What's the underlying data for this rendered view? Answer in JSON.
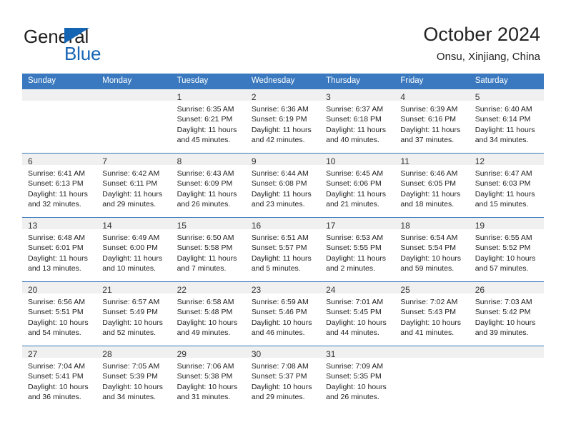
{
  "brand": {
    "name_top": "General",
    "name_bottom": "Blue",
    "accent_color": "#1464b4",
    "triangle_icon": "brand-triangle-icon"
  },
  "header": {
    "title": "October 2024",
    "subtitle": "Onsu, Xinjiang, China"
  },
  "theme": {
    "header_blue": "#3a79bf",
    "daynum_gray": "#f0f0f0",
    "text": "#222222"
  },
  "weekday_headers": [
    "Sunday",
    "Monday",
    "Tuesday",
    "Wednesday",
    "Thursday",
    "Friday",
    "Saturday"
  ],
  "labels": {
    "sunrise": "Sunrise:",
    "sunset": "Sunset:",
    "daylight": "Daylight:"
  },
  "weeks": [
    [
      {
        "day": "",
        "lines": []
      },
      {
        "day": "",
        "lines": []
      },
      {
        "day": "1",
        "lines": [
          "Sunrise: 6:35 AM",
          "Sunset: 6:21 PM",
          "Daylight: 11 hours and 45 minutes."
        ]
      },
      {
        "day": "2",
        "lines": [
          "Sunrise: 6:36 AM",
          "Sunset: 6:19 PM",
          "Daylight: 11 hours and 42 minutes."
        ]
      },
      {
        "day": "3",
        "lines": [
          "Sunrise: 6:37 AM",
          "Sunset: 6:18 PM",
          "Daylight: 11 hours and 40 minutes."
        ]
      },
      {
        "day": "4",
        "lines": [
          "Sunrise: 6:39 AM",
          "Sunset: 6:16 PM",
          "Daylight: 11 hours and 37 minutes."
        ]
      },
      {
        "day": "5",
        "lines": [
          "Sunrise: 6:40 AM",
          "Sunset: 6:14 PM",
          "Daylight: 11 hours and 34 minutes."
        ]
      }
    ],
    [
      {
        "day": "6",
        "lines": [
          "Sunrise: 6:41 AM",
          "Sunset: 6:13 PM",
          "Daylight: 11 hours and 32 minutes."
        ]
      },
      {
        "day": "7",
        "lines": [
          "Sunrise: 6:42 AM",
          "Sunset: 6:11 PM",
          "Daylight: 11 hours and 29 minutes."
        ]
      },
      {
        "day": "8",
        "lines": [
          "Sunrise: 6:43 AM",
          "Sunset: 6:09 PM",
          "Daylight: 11 hours and 26 minutes."
        ]
      },
      {
        "day": "9",
        "lines": [
          "Sunrise: 6:44 AM",
          "Sunset: 6:08 PM",
          "Daylight: 11 hours and 23 minutes."
        ]
      },
      {
        "day": "10",
        "lines": [
          "Sunrise: 6:45 AM",
          "Sunset: 6:06 PM",
          "Daylight: 11 hours and 21 minutes."
        ]
      },
      {
        "day": "11",
        "lines": [
          "Sunrise: 6:46 AM",
          "Sunset: 6:05 PM",
          "Daylight: 11 hours and 18 minutes."
        ]
      },
      {
        "day": "12",
        "lines": [
          "Sunrise: 6:47 AM",
          "Sunset: 6:03 PM",
          "Daylight: 11 hours and 15 minutes."
        ]
      }
    ],
    [
      {
        "day": "13",
        "lines": [
          "Sunrise: 6:48 AM",
          "Sunset: 6:01 PM",
          "Daylight: 11 hours and 13 minutes."
        ]
      },
      {
        "day": "14",
        "lines": [
          "Sunrise: 6:49 AM",
          "Sunset: 6:00 PM",
          "Daylight: 11 hours and 10 minutes."
        ]
      },
      {
        "day": "15",
        "lines": [
          "Sunrise: 6:50 AM",
          "Sunset: 5:58 PM",
          "Daylight: 11 hours and 7 minutes."
        ]
      },
      {
        "day": "16",
        "lines": [
          "Sunrise: 6:51 AM",
          "Sunset: 5:57 PM",
          "Daylight: 11 hours and 5 minutes."
        ]
      },
      {
        "day": "17",
        "lines": [
          "Sunrise: 6:53 AM",
          "Sunset: 5:55 PM",
          "Daylight: 11 hours and 2 minutes."
        ]
      },
      {
        "day": "18",
        "lines": [
          "Sunrise: 6:54 AM",
          "Sunset: 5:54 PM",
          "Daylight: 10 hours and 59 minutes."
        ]
      },
      {
        "day": "19",
        "lines": [
          "Sunrise: 6:55 AM",
          "Sunset: 5:52 PM",
          "Daylight: 10 hours and 57 minutes."
        ]
      }
    ],
    [
      {
        "day": "20",
        "lines": [
          "Sunrise: 6:56 AM",
          "Sunset: 5:51 PM",
          "Daylight: 10 hours and 54 minutes."
        ]
      },
      {
        "day": "21",
        "lines": [
          "Sunrise: 6:57 AM",
          "Sunset: 5:49 PM",
          "Daylight: 10 hours and 52 minutes."
        ]
      },
      {
        "day": "22",
        "lines": [
          "Sunrise: 6:58 AM",
          "Sunset: 5:48 PM",
          "Daylight: 10 hours and 49 minutes."
        ]
      },
      {
        "day": "23",
        "lines": [
          "Sunrise: 6:59 AM",
          "Sunset: 5:46 PM",
          "Daylight: 10 hours and 46 minutes."
        ]
      },
      {
        "day": "24",
        "lines": [
          "Sunrise: 7:01 AM",
          "Sunset: 5:45 PM",
          "Daylight: 10 hours and 44 minutes."
        ]
      },
      {
        "day": "25",
        "lines": [
          "Sunrise: 7:02 AM",
          "Sunset: 5:43 PM",
          "Daylight: 10 hours and 41 minutes."
        ]
      },
      {
        "day": "26",
        "lines": [
          "Sunrise: 7:03 AM",
          "Sunset: 5:42 PM",
          "Daylight: 10 hours and 39 minutes."
        ]
      }
    ],
    [
      {
        "day": "27",
        "lines": [
          "Sunrise: 7:04 AM",
          "Sunset: 5:41 PM",
          "Daylight: 10 hours and 36 minutes."
        ]
      },
      {
        "day": "28",
        "lines": [
          "Sunrise: 7:05 AM",
          "Sunset: 5:39 PM",
          "Daylight: 10 hours and 34 minutes."
        ]
      },
      {
        "day": "29",
        "lines": [
          "Sunrise: 7:06 AM",
          "Sunset: 5:38 PM",
          "Daylight: 10 hours and 31 minutes."
        ]
      },
      {
        "day": "30",
        "lines": [
          "Sunrise: 7:08 AM",
          "Sunset: 5:37 PM",
          "Daylight: 10 hours and 29 minutes."
        ]
      },
      {
        "day": "31",
        "lines": [
          "Sunrise: 7:09 AM",
          "Sunset: 5:35 PM",
          "Daylight: 10 hours and 26 minutes."
        ]
      },
      {
        "day": "",
        "lines": []
      },
      {
        "day": "",
        "lines": []
      }
    ]
  ]
}
